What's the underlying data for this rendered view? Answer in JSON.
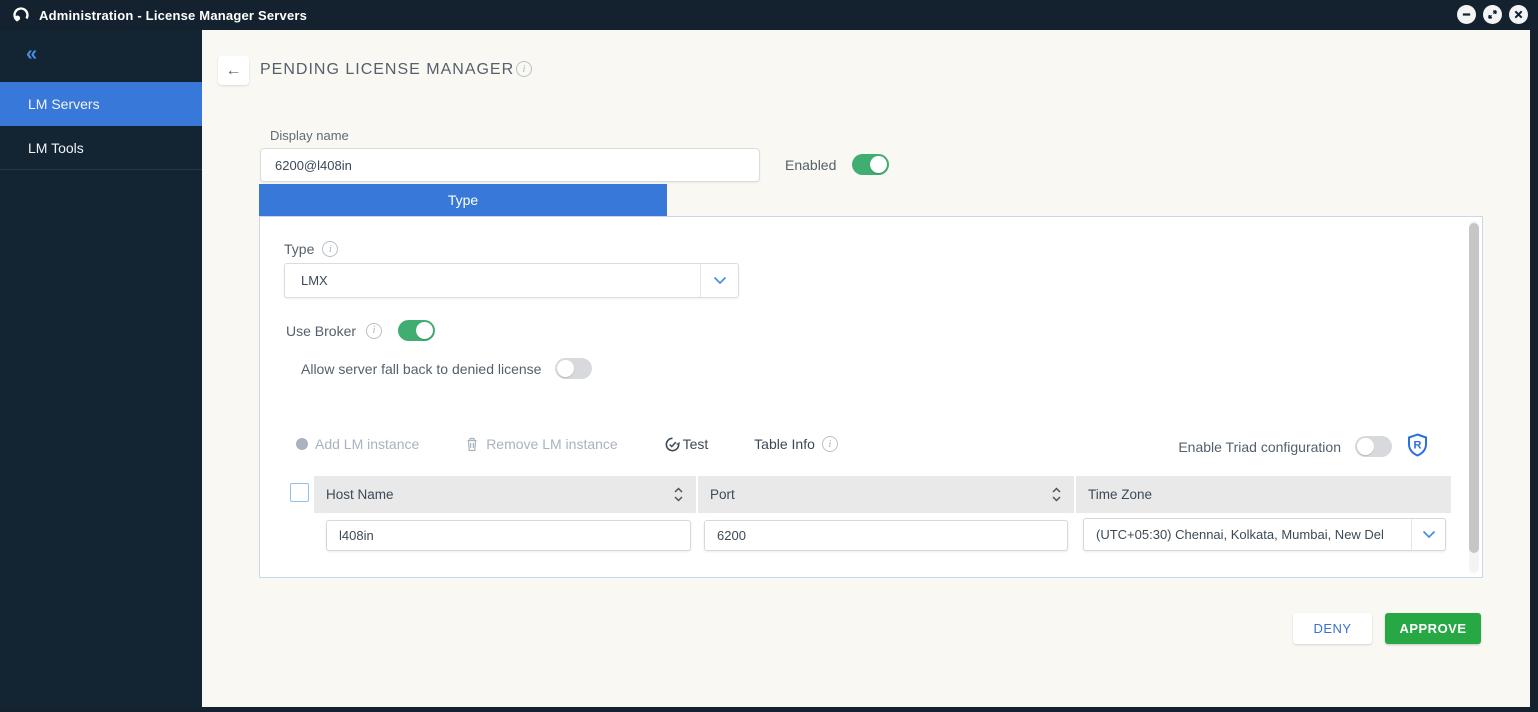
{
  "titlebar": {
    "title": "Administration - License Manager Servers"
  },
  "sidebar": {
    "collapse_glyph": "«",
    "items": [
      {
        "label": "LM Servers",
        "active": true
      },
      {
        "label": "LM Tools",
        "active": false
      }
    ]
  },
  "page": {
    "back_glyph": "←",
    "title": "PENDING LICENSE MANAGER",
    "display_name": {
      "label": "Display name",
      "value": "6200@l408in"
    },
    "enabled_toggle": {
      "label": "Enabled",
      "state": "on"
    }
  },
  "tabs": {
    "active_label": "Type"
  },
  "type_section": {
    "type_label": "Type",
    "type_value": "LMX",
    "use_broker": {
      "label": "Use Broker",
      "state": "on"
    },
    "fallback": {
      "label": "Allow server fall back to denied license",
      "state": "off"
    }
  },
  "instance_toolbar": {
    "add_label": "Add LM instance",
    "remove_label": "Remove LM instance",
    "test_label": "Test",
    "table_info_label": "Table Info",
    "triad": {
      "label": "Enable Triad configuration",
      "state": "off"
    }
  },
  "table": {
    "columns": [
      {
        "label": "Host Name",
        "sortable": true
      },
      {
        "label": "Port",
        "sortable": true
      },
      {
        "label": "Time Zone",
        "sortable": false
      }
    ],
    "rows": [
      {
        "host_name": "l408in",
        "port": "6200",
        "time_zone": "(UTC+05:30) Chennai, Kolkata, Mumbai, New Del"
      }
    ]
  },
  "footer": {
    "deny_label": "DENY",
    "approve_label": "APPROVE"
  },
  "colors": {
    "accent_blue": "#3878d8",
    "toggle_green": "#3fae70",
    "approve_green": "#28a745",
    "titlebar_dark": "#14222f",
    "content_bg": "#faf8f3"
  }
}
